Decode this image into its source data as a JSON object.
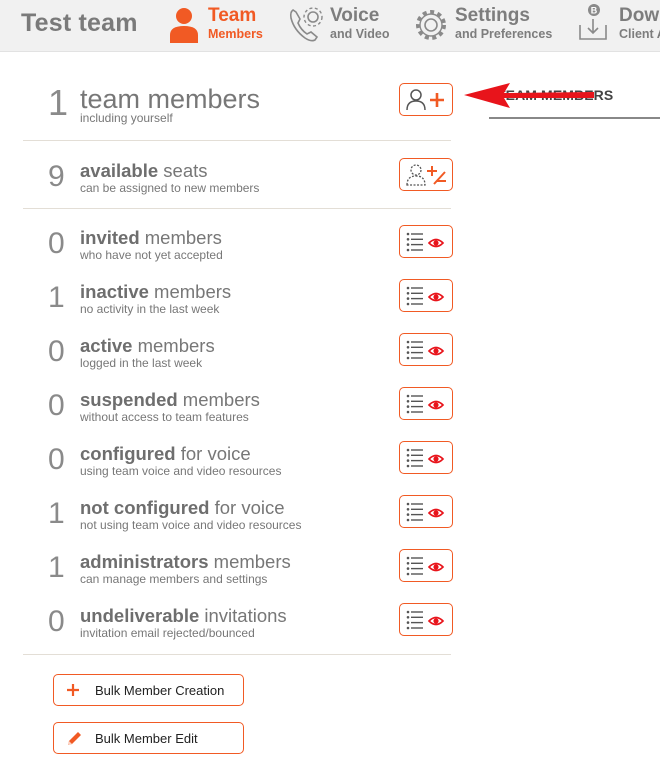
{
  "header": {
    "team_name": "Test team",
    "nav": [
      {
        "main": "Team",
        "sub": "Members",
        "icon": "person-icon",
        "active": true
      },
      {
        "main": "Voice",
        "sub": "and Video",
        "icon": "phone-gear-icon",
        "active": false
      },
      {
        "main": "Settings",
        "sub": "and Preferences",
        "icon": "gear-icon",
        "active": false
      },
      {
        "main": "Dow",
        "sub": "Client A",
        "icon": "download-icon",
        "active": false
      }
    ]
  },
  "stats": [
    {
      "num": "1",
      "bold": "",
      "rest": "team members",
      "sub": "including yourself",
      "button_icon": "add-member-icon"
    },
    {
      "num": "9",
      "bold": "available",
      "rest": " seats",
      "sub": "can be assigned to new members",
      "button_icon": "assign-seats-icon"
    },
    {
      "num": "0",
      "bold": "invited",
      "rest": " members",
      "sub": "who have not yet accepted",
      "button_icon": "view-list-icon"
    },
    {
      "num": "1",
      "bold": "inactive",
      "rest": " members",
      "sub": "no activity in the last week",
      "button_icon": "view-list-icon"
    },
    {
      "num": "0",
      "bold": "active",
      "rest": " members",
      "sub": "logged in the last week",
      "button_icon": "view-list-icon"
    },
    {
      "num": "0",
      "bold": "suspended",
      "rest": " members",
      "sub": "without access to team features",
      "button_icon": "view-list-icon"
    },
    {
      "num": "0",
      "bold": "configured",
      "rest": " for voice",
      "sub": "using team voice and video resources",
      "button_icon": "view-list-icon"
    },
    {
      "num": "1",
      "bold": "not configured",
      "rest": " for voice",
      "sub": "not using team voice and video resources",
      "button_icon": "view-list-icon"
    },
    {
      "num": "1",
      "bold": "administrators",
      "rest": " members",
      "sub": "can manage members and settings",
      "button_icon": "view-list-icon"
    },
    {
      "num": "0",
      "bold": "undeliverable",
      "rest": " invitations",
      "sub": "invitation email rejected/bounced",
      "button_icon": "view-list-icon"
    }
  ],
  "actions": {
    "bulk_create": "Bulk Member Creation",
    "bulk_edit": "Bulk Member Edit"
  },
  "right_panel": {
    "title": "TEAM MEMBERS"
  },
  "colors": {
    "accent": "#f15a24",
    "annotation_arrow": "#e8141b"
  }
}
